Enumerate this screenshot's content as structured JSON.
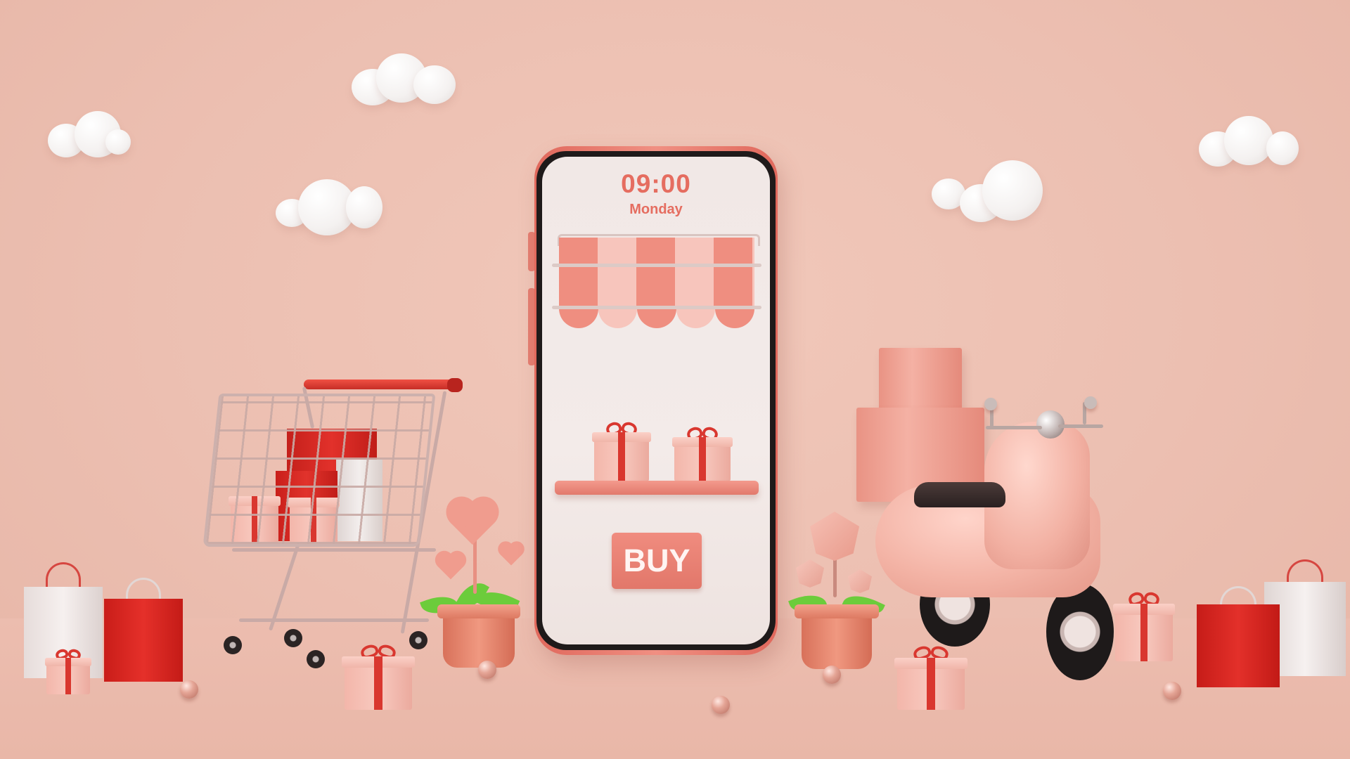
{
  "phone": {
    "time": "09:00",
    "day": "Monday",
    "buy_label": "BUY"
  },
  "colors": {
    "background": "#ecbfb1",
    "phone_frame": "#ea7e71",
    "accent_red": "#d9372f",
    "screen": "#f2e9e7"
  },
  "icons": [
    "cloud-icon",
    "shopping-cart-icon",
    "gift-box-icon",
    "shopping-bag-icon",
    "scooter-icon",
    "potted-plant-icon",
    "heart-icon",
    "awning-icon"
  ]
}
